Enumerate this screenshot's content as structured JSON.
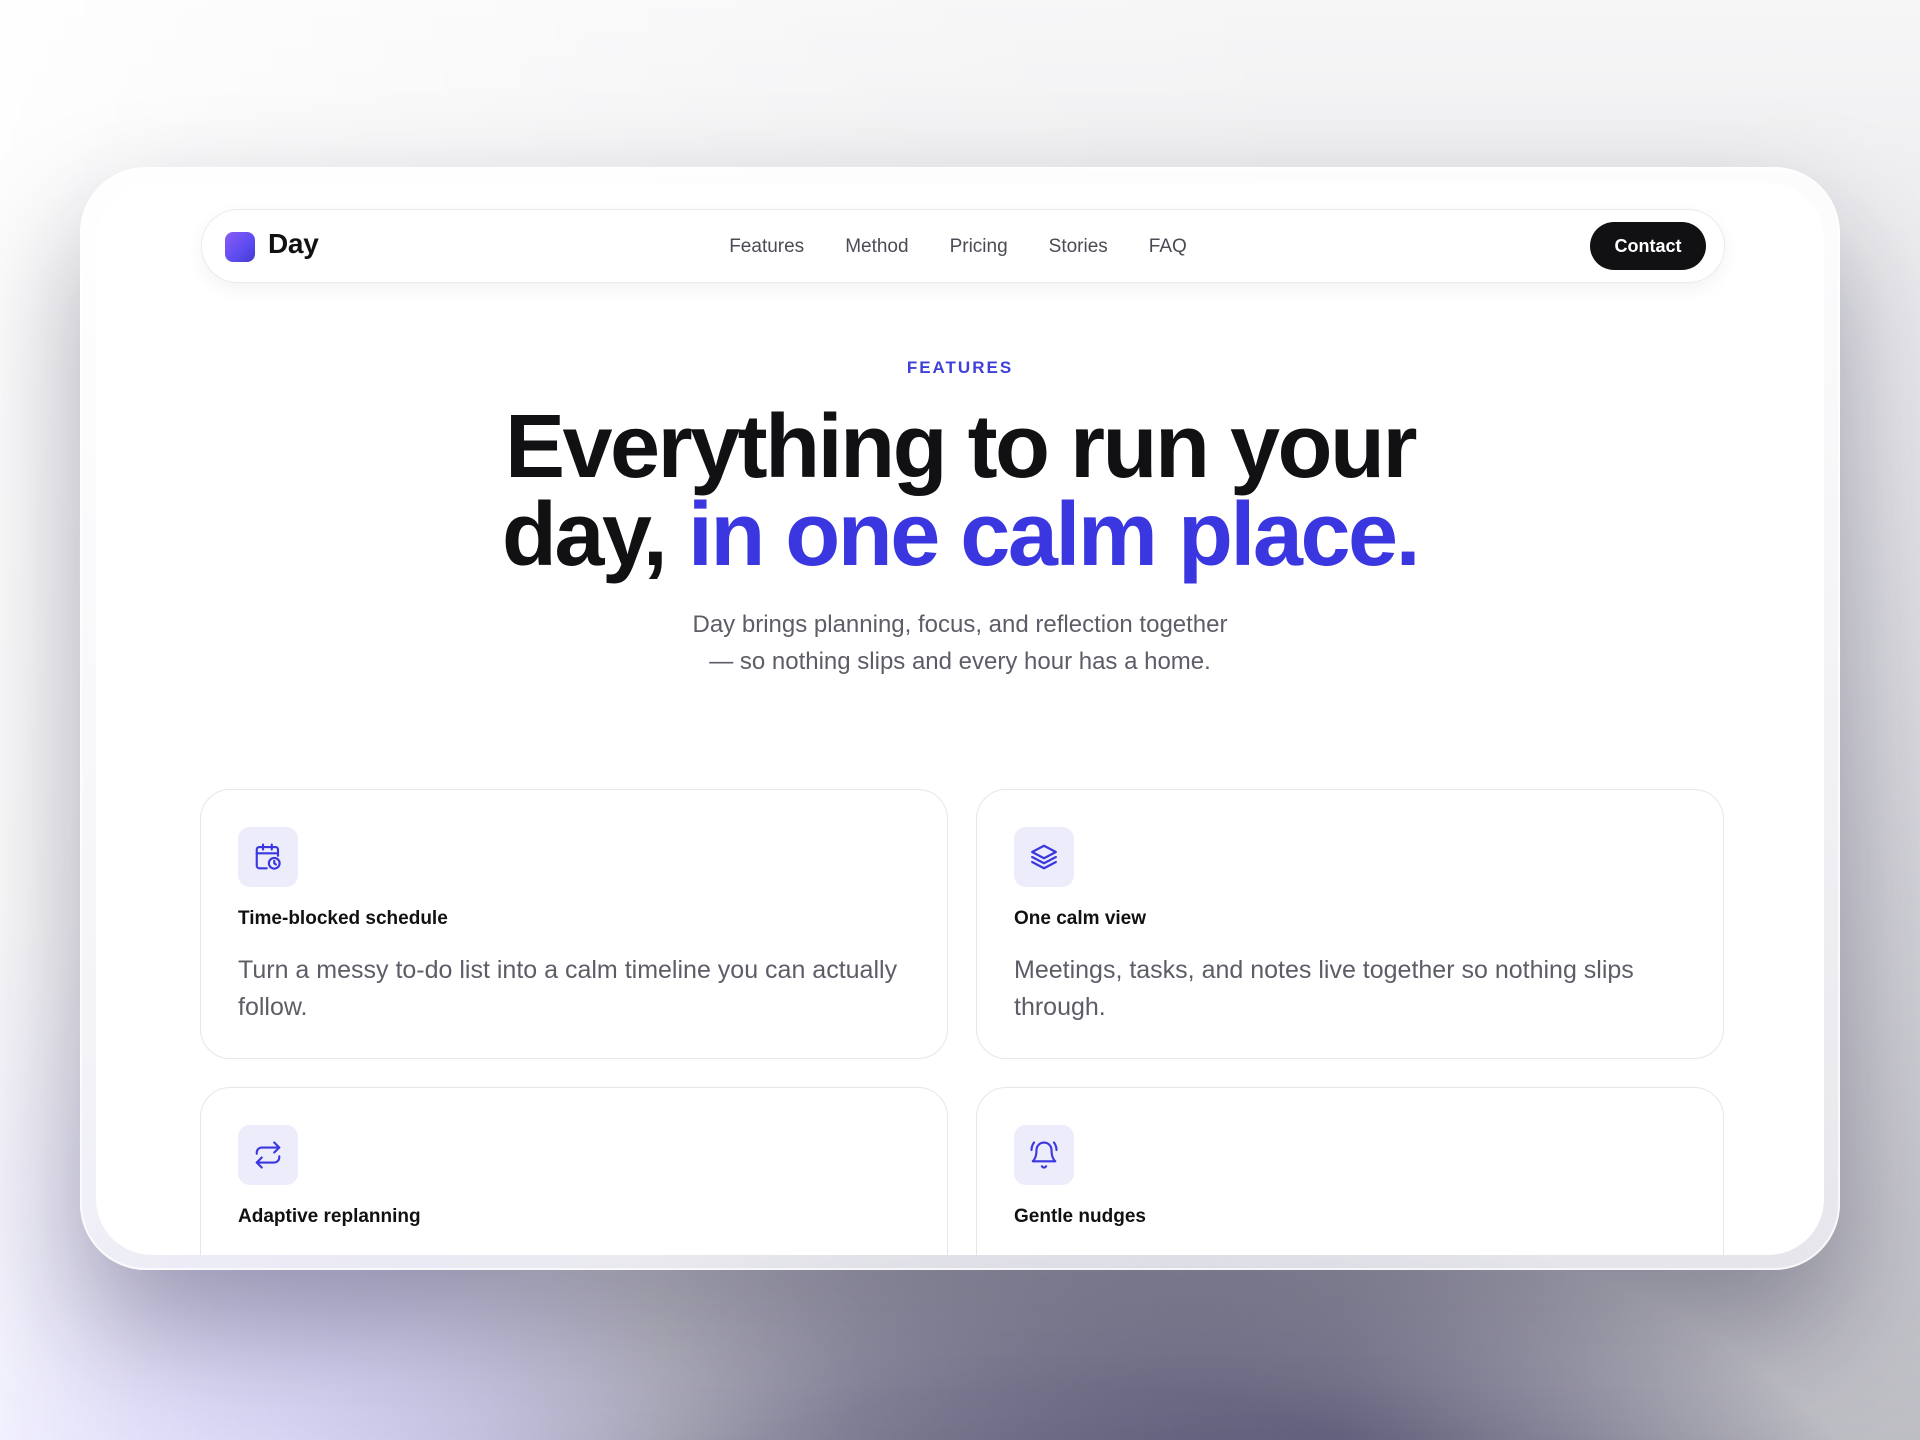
{
  "brand": {
    "name": "Day"
  },
  "nav": {
    "links": [
      "Features",
      "Method",
      "Pricing",
      "Stories",
      "FAQ"
    ],
    "cta_label": "Contact"
  },
  "hero": {
    "eyebrow": "FEATURES",
    "headline_line1": "Everything to run your",
    "headline_line2_plain": "day,",
    "headline_line2_accent": "in one calm place.",
    "subline_1": "Day brings planning, focus, and reflection together",
    "subline_2": "— so nothing slips and every hour has a home."
  },
  "features": [
    {
      "icon": "calendar-clock-icon",
      "title": "Time-blocked schedule",
      "description": "Turn a messy to-do list into a calm timeline you can actually follow."
    },
    {
      "icon": "layers-icon",
      "title": "One calm view",
      "description": "Meetings, tasks, and notes live together so nothing slips through."
    },
    {
      "icon": "repeat-arrows-icon",
      "title": "Adaptive replanning",
      "description": ""
    },
    {
      "icon": "bell-icon",
      "title": "Gentle nudges",
      "description": ""
    }
  ],
  "colors": {
    "accent": "#3a36e0",
    "eyebrow": "#3f3fd9",
    "icon_bg": "#ececfb",
    "cta_bg": "#111114",
    "text_primary": "#111114",
    "text_muted": "#5d5d68"
  }
}
